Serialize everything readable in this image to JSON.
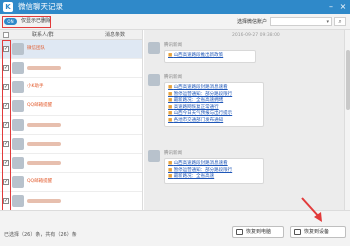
{
  "window": {
    "title": "微信聊天记录",
    "logo_text": "K",
    "controls": [
      "–",
      "×"
    ]
  },
  "toolbar": {
    "toggle_text": "ON",
    "show_deleted_label": "仅显示已删除",
    "device_label": "选择微信账户",
    "device_value": "",
    "search_icon": "search-icon"
  },
  "list": {
    "header_contact": "联系人/群",
    "header_count": "消息条数",
    "rows": [
      {
        "name": "微信团队",
        "blurred": false,
        "count": "",
        "checked": true
      },
      {
        "name": "",
        "blurred": true,
        "count": "",
        "checked": true
      },
      {
        "name": "小K助手",
        "blurred": false,
        "count": "",
        "checked": true
      },
      {
        "name": "QQ邮箱提醒",
        "blurred": false,
        "count": "",
        "checked": true
      },
      {
        "name": "",
        "blurred": true,
        "count": "",
        "checked": true
      },
      {
        "name": "",
        "blurred": true,
        "count": "",
        "checked": true
      },
      {
        "name": "",
        "blurred": true,
        "count": "",
        "checked": true
      },
      {
        "name": "QQ邮箱提醒",
        "blurred": false,
        "count": "",
        "checked": true
      },
      {
        "name": "",
        "blurred": true,
        "count": "",
        "checked": true
      }
    ]
  },
  "detail": {
    "timestamp": "2016-09-27 09:38:00",
    "messages": [
      {
        "sender": "腾讯新闻",
        "lines": [
          "山西高速路段推出新政策"
        ]
      },
      {
        "sender": "腾讯新闻",
        "lines": [
          "山西高速路段封路消息速看",
          "暂停运营通知：部分路段限行",
          "最新路况：全省高速拥堵",
          "高速路网恢复正常通行",
          "山西今日天气预报与出行提示",
          "各地市交通部门发布通知"
        ]
      },
      {
        "sender": "腾讯新闻",
        "lines": [
          "山西高速路段封路消息速看",
          "暂停运营通知：部分路段限行",
          "最新路况：全省高速"
        ]
      }
    ]
  },
  "footer": {
    "status_text": "已选择（26）条，共有（26）条",
    "export_pc_label": "恢复到电脑",
    "export_device_label": "恢复到设备"
  },
  "colors": {
    "titlebar": "#2f89c9",
    "highlight_box": "#e23b3b",
    "link": "#1f57b8"
  }
}
